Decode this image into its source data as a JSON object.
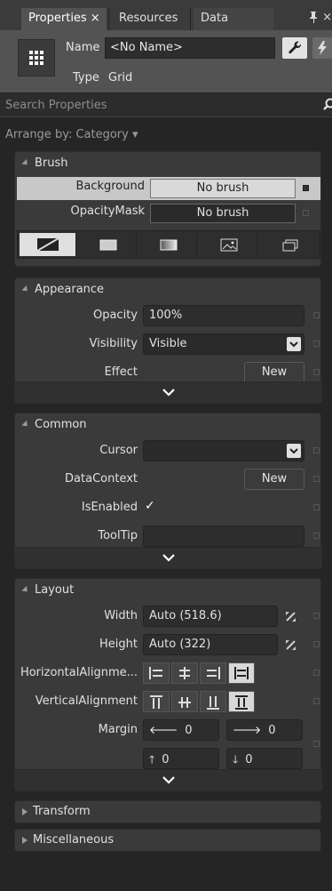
{
  "tabs": [
    {
      "label": "Properties",
      "close": "×",
      "active": true
    },
    {
      "label": "Resources",
      "active": false
    },
    {
      "label": "Data",
      "active": false
    }
  ],
  "window": {
    "pin_glyph": "ᵖ",
    "close_glyph": "×"
  },
  "header": {
    "name_label": "Name",
    "name_value": "<No Name>",
    "type_label": "Type",
    "type_value": "Grid"
  },
  "search": {
    "placeholder": "Search Properties"
  },
  "arrange": {
    "label": "Arrange by: Category ▾"
  },
  "brush": {
    "title": "Brush",
    "rows": [
      {
        "label": "Background",
        "value": "No brush"
      },
      {
        "label": "OpacityMask",
        "value": "No brush"
      }
    ]
  },
  "appearance": {
    "title": "Appearance",
    "opacity_label": "Opacity",
    "opacity_value": "100%",
    "visibility_label": "Visibility",
    "visibility_value": "Visible",
    "effect_label": "Effect",
    "effect_button": "New"
  },
  "common": {
    "title": "Common",
    "cursor_label": "Cursor",
    "cursor_value": "",
    "datacontext_label": "DataContext",
    "datacontext_button": "New",
    "isenabled_label": "IsEnabled",
    "isenabled_check": "✓",
    "tooltip_label": "ToolTip",
    "tooltip_value": ""
  },
  "layout": {
    "title": "Layout",
    "width_label": "Width",
    "width_value": "Auto (518.6)",
    "height_label": "Height",
    "height_value": "Auto (322)",
    "halign_label": "HorizontalAlignme...",
    "valign_label": "VerticalAlignment",
    "margin_label": "Margin",
    "margin": {
      "left": "0",
      "right": "0",
      "top": "0",
      "bottom": "0"
    },
    "margin_arrows": {
      "left": "🡐",
      "right": "🡒",
      "top": "🡑",
      "bottom": "🡓"
    }
  },
  "collapsed": [
    {
      "title": "Transform"
    },
    {
      "title": "Miscellaneous"
    }
  ],
  "colors": {
    "panel": "#3a3a3a",
    "header": "#535353",
    "field": "#2d2d2d"
  }
}
